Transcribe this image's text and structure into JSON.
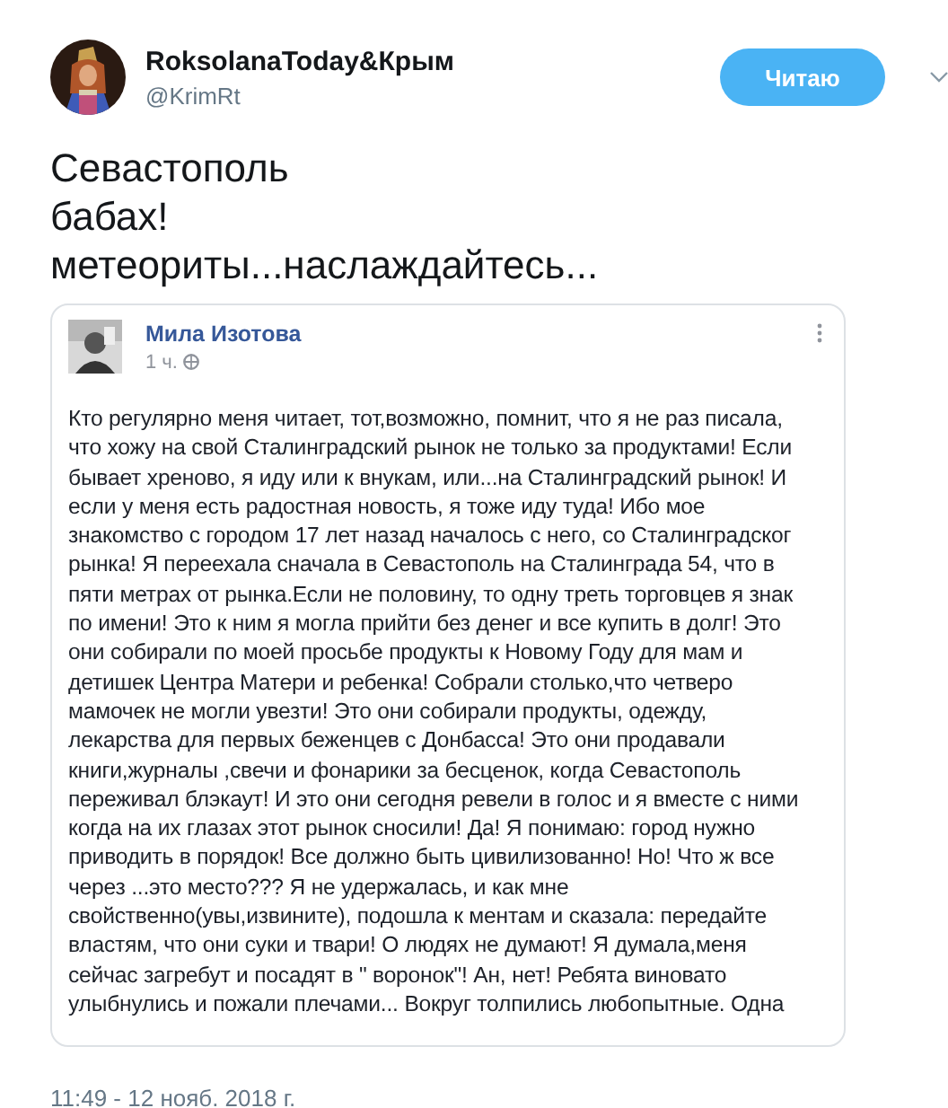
{
  "author": {
    "name": "RoksolanaToday&Крым",
    "handle": "@KrimRt"
  },
  "follow_button": {
    "label": "Читаю"
  },
  "tweet_lines": [
    "Севастополь",
    "бабах!",
    "метеориты...наслаждайтесь..."
  ],
  "embedded_post": {
    "author": "Мила Изотова",
    "time": "1 ч.",
    "lines": [
      "Кто регулярно меня читает, тот,возможно, помнит, что я не раз писала,",
      "что хожу на свой Сталинградский рынок не только за продуктами! Если",
      "бывает хреново, я иду или к внукам, или...на Сталинградский рынок! И",
      "если у меня есть радостная новость, я тоже иду туда! Ибо мое",
      "знакомство с городом 17 лет назад началось с него, со Сталинградског",
      "рынка! Я переехала сначала в Севастополь на Сталинграда 54, что в",
      "пяти метрах от рынка.Если не половину, то одну треть торговцев я знак",
      "по имени! Это к ним я могла прийти без денег и все купить в долг! Это",
      "они собирали по моей просьбе продукты к Новому Году для мам и",
      "детишек Центра Матери и ребенка! Собрали столько,что четверо",
      "мамочек не могли увезти! Это они собирали продукты, одежду,",
      "лекарства для первых беженцев с Донбасса! Это они продавали",
      "книги,журналы ,свечи и фонарики за бесценок, когда Севастополь",
      "переживал блэкаут! И это они сегодня ревели в голос и я вместе с ними",
      "когда на их глазах этот рынок сносили! Да! Я понимаю: город нужно",
      "приводить в порядок! Все должно быть цивилизованно! Но! Что ж все",
      "через ...это место??? Я не удержалась, и как мне",
      "свойственно(увы,извините), подошла к ментам и сказала: передайте",
      "властям, что они суки и твари! О людях не думают! Я думала,меня",
      "сейчас загребут и посадят в \" воронок\"! Ан, нет! Ребята виновато",
      "улыбнулись и пожали плечами... Вокруг толпились любопытные. Одна"
    ]
  },
  "timestamp": "11:49 - 12 нояб. 2018 г."
}
